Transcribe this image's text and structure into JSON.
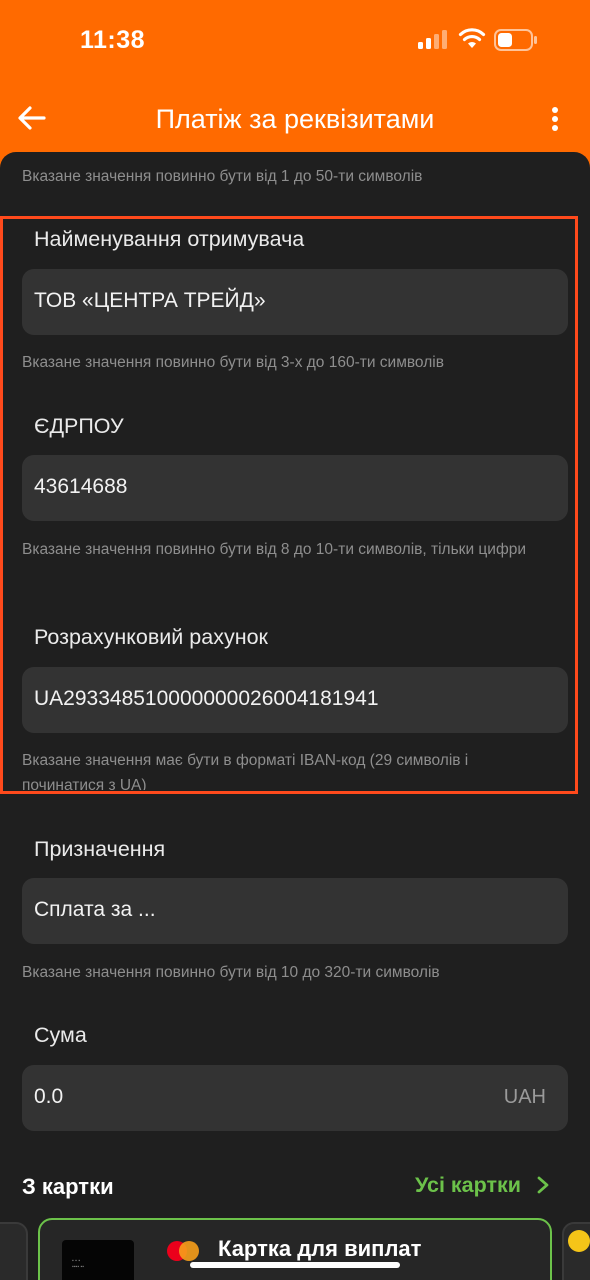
{
  "status_bar": {
    "time": "11:38"
  },
  "nav": {
    "title": "Платіж за реквізитами",
    "back_icon": "arrow-left-icon",
    "more_icon": "more-vertical-icon"
  },
  "top_hint": "Вказане значення повинно бути від 1 до 50-ти символів",
  "fields": {
    "recipient": {
      "label": "Найменування отримувача",
      "value": "ТОВ «ЦЕНТРА ТРЕЙД»",
      "hint": "Вказане значення повинно бути від 3-х до 160-ти символів"
    },
    "edrpou": {
      "label": "ЄДРПОУ",
      "value": "43614688",
      "hint": "Вказане значення повинно бути від 8 до 10-ти символів, тільки цифри"
    },
    "account": {
      "label": "Розрахунковий рахунок",
      "value": "UA293348510000000026004181941",
      "hint": "Вказане значення має бути в форматі IBAN-код (29 символів і починатися з UA)"
    },
    "purpose": {
      "label": "Призначення",
      "value": "Сплата за ...",
      "hint": "Вказане значення повинно бути від 10 до 320-ти символів"
    },
    "amount": {
      "label": "Сума",
      "value": "0.0",
      "currency": "UAH"
    }
  },
  "cards_section": {
    "title": "З картки",
    "all_cards_label": "Усі картки",
    "card": {
      "name": "Картка для виплат"
    }
  },
  "colors": {
    "brand": "#ff6a00",
    "accent_green": "#6cc24a",
    "highlight_border": "#ff4a1c",
    "background": "#1f1f1f",
    "field": "#333333"
  }
}
